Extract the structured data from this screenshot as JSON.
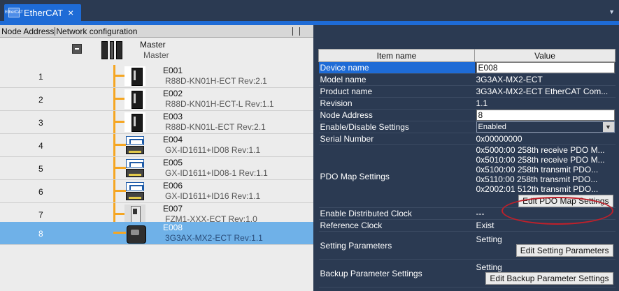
{
  "tab": {
    "label": "EtherCAT",
    "close": "×",
    "icon_text": "EtherCAT",
    "menu_arrow": "▼"
  },
  "left": {
    "header": {
      "node_address": "Node Address",
      "network_configuration": "Network configuration"
    },
    "master": {
      "name": "Master",
      "model": "Master"
    },
    "nodes": [
      {
        "num": "1",
        "name": "E001",
        "model": "R88D-KN01H-ECT Rev:2.1",
        "icon": "servo-icon"
      },
      {
        "num": "2",
        "name": "E002",
        "model": "R88D-KN01H-ECT-L Rev:1.1",
        "icon": "servo-icon"
      },
      {
        "num": "3",
        "name": "E003",
        "model": "R88D-KN01L-ECT Rev:2.1",
        "icon": "servo-icon"
      },
      {
        "num": "4",
        "name": "E004",
        "model": "GX-ID1611+ID08 Rev:1.1",
        "icon": "io-icon"
      },
      {
        "num": "5",
        "name": "E005",
        "model": "GX-ID1611+ID08-1 Rev:1.1",
        "icon": "io-icon"
      },
      {
        "num": "6",
        "name": "E006",
        "model": "GX-ID1611+ID16 Rev:1.1",
        "icon": "io-icon"
      },
      {
        "num": "7",
        "name": "E007",
        "model": "FZM1-XXX-ECT Rev:1.0",
        "icon": "sensor-icon"
      },
      {
        "num": "8",
        "name": "E008",
        "model": "3G3AX-MX2-ECT Rev:1.1",
        "icon": "inverter-icon"
      }
    ]
  },
  "props": {
    "header": {
      "item_name": "Item name",
      "value": "Value"
    },
    "rows": {
      "device_name": {
        "name": "Device name",
        "value": "E008"
      },
      "model_name": {
        "name": "Model name",
        "value": "3G3AX-MX2-ECT"
      },
      "product_name": {
        "name": "Product name",
        "value": "3G3AX-MX2-ECT EtherCAT Com..."
      },
      "revision": {
        "name": "Revision",
        "value": "1.1"
      },
      "node_address": {
        "name": "Node Address",
        "value": "8"
      },
      "enable_disable": {
        "name": "Enable/Disable Settings",
        "value": "Enabled"
      },
      "serial_number": {
        "name": "Serial Number",
        "value": "0x00000000"
      },
      "pdo_map": {
        "name": "PDO Map Settings",
        "lines": [
          "0x5000:00 258th receive PDO M...",
          "0x5010:00 258th receive PDO M...",
          "0x5100:00 258th transmit PDO...",
          "0x5110:00 258th transmit PDO...",
          "0x2002:01 512th transmit PDO..."
        ],
        "button": "Edit PDO Map Settings"
      },
      "distributed_clock": {
        "name": "Enable Distributed Clock",
        "value": "---"
      },
      "reference_clock": {
        "name": "Reference Clock",
        "value": "Exist"
      },
      "setting_parameters": {
        "name": "Setting Parameters",
        "value": "Setting",
        "button": "Edit Setting Parameters"
      },
      "backup_parameters": {
        "name": "Backup Parameter Settings",
        "value": "Setting",
        "button": "Edit Backup Parameter Settings"
      }
    }
  },
  "colors": {
    "accent": "#1e6bd6",
    "selected_row": "#6fb1e8",
    "connector": "#f5a623",
    "highlight_ellipse": "#c0202a"
  }
}
